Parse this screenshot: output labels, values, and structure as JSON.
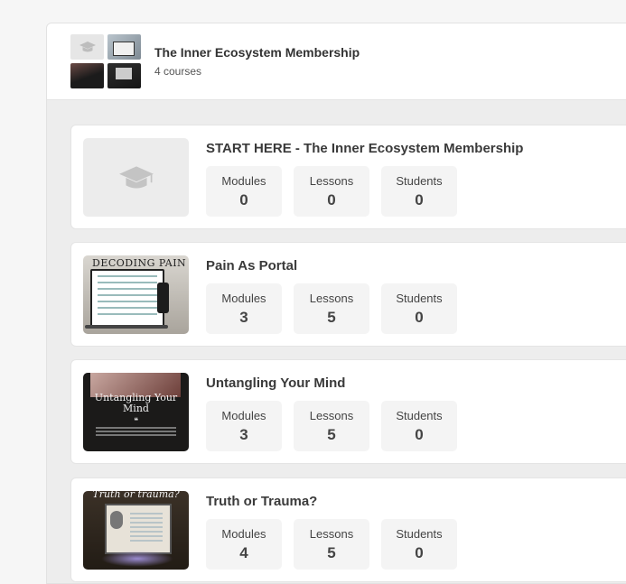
{
  "membership": {
    "title": "The Inner Ecosystem Membership",
    "course_count": "4 courses"
  },
  "courses": [
    {
      "title": "START HERE - The Inner Ecosystem Membership",
      "thumbnail": "graduation-cap-icon",
      "stats": [
        {
          "label": "Modules",
          "value": "0"
        },
        {
          "label": "Lessons",
          "value": "0"
        },
        {
          "label": "Students",
          "value": "0"
        }
      ]
    },
    {
      "title": "Pain As Portal",
      "thumbnail_text": "DECODING PAIN",
      "stats": [
        {
          "label": "Modules",
          "value": "3"
        },
        {
          "label": "Lessons",
          "value": "5"
        },
        {
          "label": "Students",
          "value": "0"
        }
      ]
    },
    {
      "title": "Untangling Your Mind",
      "thumbnail_text": "Untangling Your Mind",
      "stats": [
        {
          "label": "Modules",
          "value": "3"
        },
        {
          "label": "Lessons",
          "value": "5"
        },
        {
          "label": "Students",
          "value": "0"
        }
      ]
    },
    {
      "title": "Truth or Trauma?",
      "thumbnail_text": "Truth or trauma?",
      "stats": [
        {
          "label": "Modules",
          "value": "4"
        },
        {
          "label": "Lessons",
          "value": "5"
        },
        {
          "label": "Students",
          "value": "0"
        }
      ]
    }
  ]
}
